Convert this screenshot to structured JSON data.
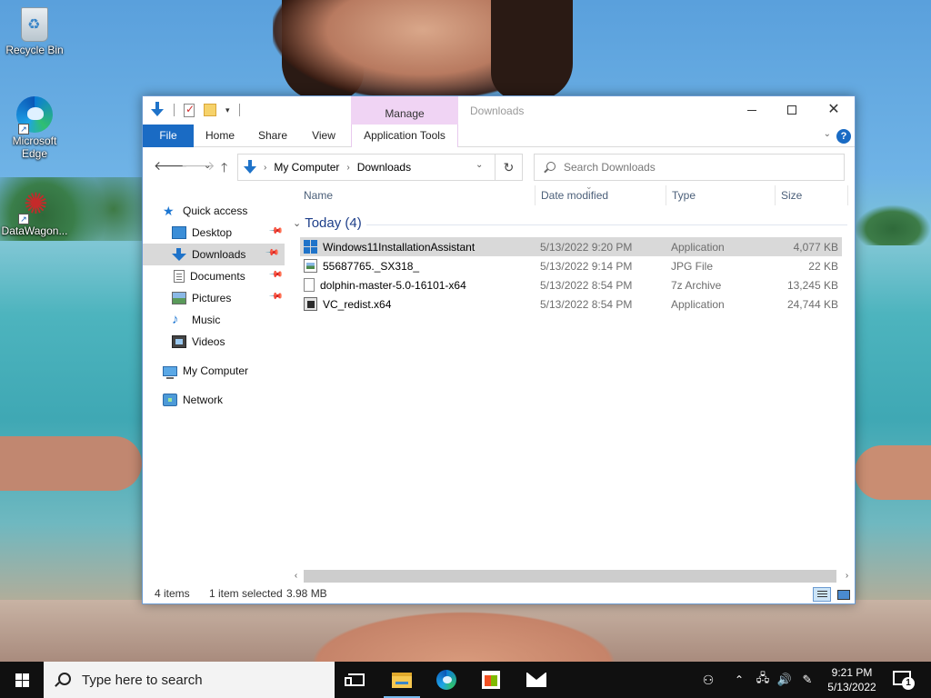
{
  "desktop": {
    "icons": [
      {
        "label": "Recycle Bin",
        "icon": "recycle-bin-icon"
      },
      {
        "label": "Microsoft Edge",
        "icon": "edge-icon"
      },
      {
        "label": "DataWagon...",
        "icon": "datawagon-icon"
      }
    ]
  },
  "window": {
    "context_tab": "Manage",
    "context_title": "Downloads",
    "ribbon_tabs": [
      "File",
      "Home",
      "Share",
      "View",
      "Application Tools"
    ],
    "address": {
      "root": "My Computer",
      "folder": "Downloads"
    },
    "search": {
      "placeholder": "Search Downloads"
    },
    "sidebar": {
      "items": [
        {
          "label": "Quick access",
          "icon": "star-icon",
          "pinned": false
        },
        {
          "label": "Desktop",
          "icon": "desktop-icon",
          "pinned": true
        },
        {
          "label": "Downloads",
          "icon": "download-icon",
          "pinned": true,
          "selected": true
        },
        {
          "label": "Documents",
          "icon": "documents-icon",
          "pinned": true
        },
        {
          "label": "Pictures",
          "icon": "pictures-icon",
          "pinned": true
        },
        {
          "label": "Music",
          "icon": "music-icon",
          "pinned": false
        },
        {
          "label": "Videos",
          "icon": "videos-icon",
          "pinned": false
        },
        {
          "label": "My Computer",
          "icon": "computer-icon",
          "pinned": false
        },
        {
          "label": "Network",
          "icon": "network-icon",
          "pinned": false
        }
      ]
    },
    "columns": {
      "name": "Name",
      "date": "Date modified",
      "type": "Type",
      "size": "Size"
    },
    "group": {
      "label": "Today (4)"
    },
    "files": [
      {
        "name": "Windows11InstallationAssistant",
        "date": "5/13/2022 9:20 PM",
        "type": "Application",
        "size": "4,077 KB",
        "icon": "windows-app-icon",
        "selected": true
      },
      {
        "name": "55687765._SX318_",
        "date": "5/13/2022 9:14 PM",
        "type": "JPG File",
        "size": "22 KB",
        "icon": "jpg-file-icon"
      },
      {
        "name": "dolphin-master-5.0-16101-x64",
        "date": "5/13/2022 8:54 PM",
        "type": "7z Archive",
        "size": "13,245 KB",
        "icon": "archive-file-icon"
      },
      {
        "name": "VC_redist.x64",
        "date": "5/13/2022 8:54 PM",
        "type": "Application",
        "size": "24,744 KB",
        "icon": "installer-icon"
      }
    ],
    "status": {
      "count": "4 items",
      "selection": "1 item selected",
      "size": "3.98 MB"
    }
  },
  "taskbar": {
    "search_placeholder": "Type here to search",
    "time": "9:21 PM",
    "date": "5/13/2022",
    "notification_count": "1"
  }
}
